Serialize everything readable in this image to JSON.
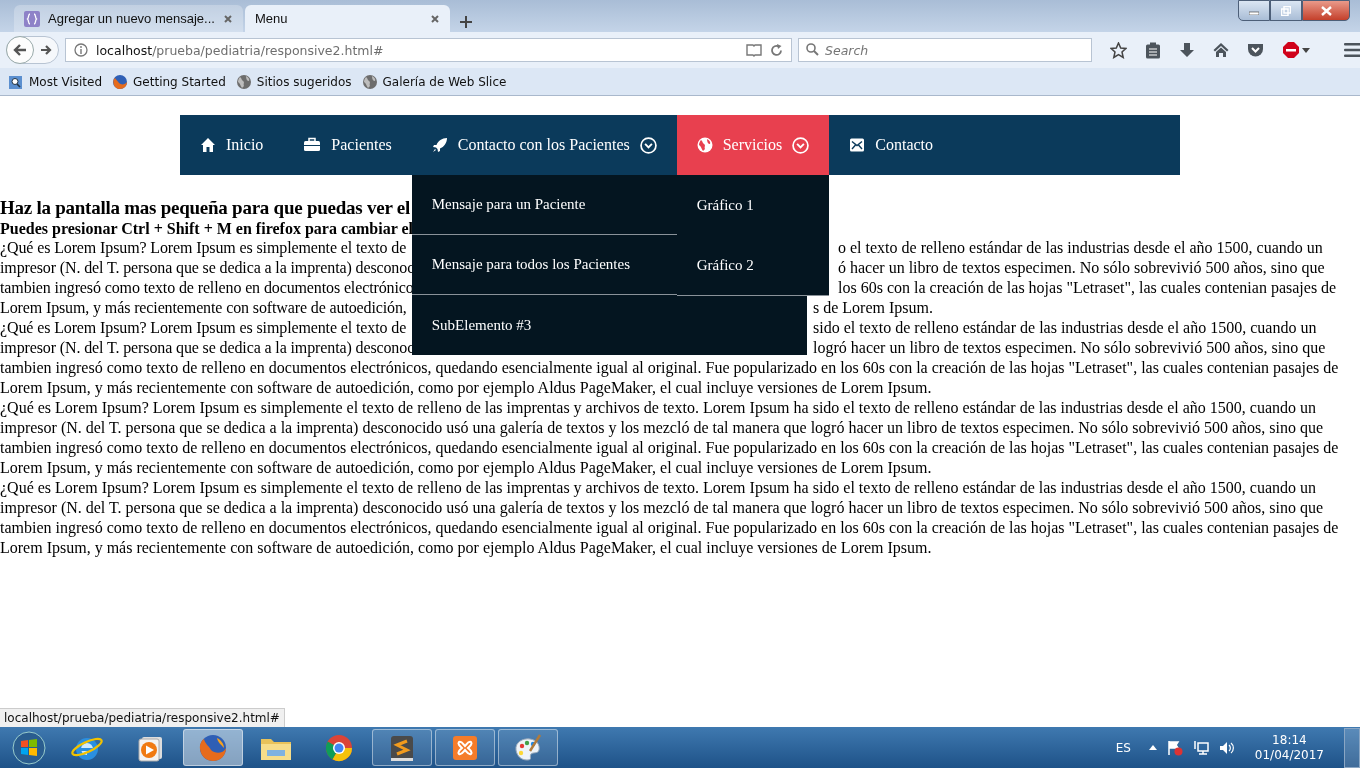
{
  "browser": {
    "tabs": [
      {
        "title": "Agregar un nuevo mensaje...",
        "selected": false
      },
      {
        "title": "Menu",
        "selected": true
      }
    ],
    "url_host": "localhost",
    "url_path": "/prueba/pediatria/responsive2.html#",
    "search": {
      "placeholder": "Search"
    },
    "bookmarks": [
      {
        "label": "Most Visited",
        "kind": "folder"
      },
      {
        "label": "Getting Started",
        "kind": "fox"
      },
      {
        "label": "Sitios sugeridos",
        "kind": "globe"
      },
      {
        "label": "Galería de Web Slice",
        "kind": "globe"
      }
    ]
  },
  "nav": {
    "items": [
      {
        "label": "Inicio",
        "selected": false
      },
      {
        "label": "Pacientes",
        "selected": false
      },
      {
        "label": "Contacto con los Pacientes",
        "selected": false,
        "expanded": true,
        "submenu": [
          "Mensaje para un Paciente",
          "Mensaje para todos los Pacientes",
          "SubElemento #3"
        ]
      },
      {
        "label": "Servicios",
        "selected": true,
        "expanded": true,
        "submenu": [
          "Gráfico 1",
          "Gráfico 2"
        ]
      },
      {
        "label": "Contacto",
        "selected": false
      }
    ]
  },
  "content": {
    "heading": "Haz la pantalla mas pequeña para que puedas ver el",
    "subheading": "Puedes presionar Ctrl + Shift + M en firefox para cambiar el",
    "covered_lines": [
      {
        "left": "¿Qué es Lorem Ipsum? Lorem Ipsum es simplemente el texto de",
        "right": "o el texto de relleno estándar de las industrias desde el año 1500, cuando un"
      },
      {
        "left": "impresor (N. del T. persona que se dedica a la imprenta) desconoc",
        "right": "ó hacer un libro de textos especimen. No sólo sobrevivió 500 años, sino que"
      },
      {
        "left": "tambien ingresó como texto de relleno en documentos electrónico",
        "right": "los 60s con la creación de las hojas \"Letraset\", las cuales contenian pasajes de"
      },
      {
        "left": "Lorem Ipsum, y más recientemente con software de autoedición,",
        "right": "s de Lorem Ipsum."
      },
      {
        "left": "¿Qué es Lorem Ipsum? Lorem Ipsum es simplemente el texto de",
        "right": "sido el texto de relleno estándar de las industrias desde el año 1500, cuando un"
      },
      {
        "left": "impresor (N. del T. persona que se dedica a la imprenta) desconoc",
        "right": "logró hacer un libro de textos especimen. No sólo sobrevivió 500 años, sino que"
      }
    ],
    "paragraphs": [
      "tambien ingresó como texto de relleno en documentos electrónicos, quedando esencialmente igual al original. Fue popularizado en los 60s con la creación de las hojas \"Letraset\", las cuales contenian pasajes de Lorem Ipsum, y más recientemente con software de autoedición, como por ejemplo Aldus PageMaker, el cual incluye versiones de Lorem Ipsum.",
      "¿Qué es Lorem Ipsum? Lorem Ipsum es simplemente el texto de relleno de las imprentas y archivos de texto. Lorem Ipsum ha sido el texto de relleno estándar de las industrias desde el año 1500, cuando un impresor (N. del T. persona que se dedica a la imprenta) desconocido usó una galería de textos y los mezcló de tal manera que logró hacer un libro de textos especimen. No sólo sobrevivió 500 años, sino que tambien ingresó como texto de relleno en documentos electrónicos, quedando esencialmente igual al original. Fue popularizado en los 60s con la creación de las hojas \"Letraset\", las cuales contenian pasajes de Lorem Ipsum, y más recientemente con software de autoedición, como por ejemplo Aldus PageMaker, el cual incluye versiones de Lorem Ipsum.",
      "¿Qué es Lorem Ipsum? Lorem Ipsum es simplemente el texto de relleno de las imprentas y archivos de texto. Lorem Ipsum ha sido el texto de relleno estándar de las industrias desde el año 1500, cuando un impresor (N. del T. persona que se dedica a la imprenta) desconocido usó una galería de textos y los mezcló de tal manera que logró hacer un libro de textos especimen. No sólo sobrevivió 500 años, sino que tambien ingresó como texto de relleno en documentos electrónicos, quedando esencialmente igual al original. Fue popularizado en los 60s con la creación de las hojas \"Letraset\", las cuales contenian pasajes de Lorem Ipsum, y más recientemente con software de autoedición, como por ejemplo Aldus PageMaker, el cual incluye versiones de Lorem Ipsum."
    ]
  },
  "status_bar": "localhost/prueba/pediatria/responsive2.html#",
  "taskbar": {
    "apps": [
      {
        "kind": "ie",
        "running": false,
        "selected": false
      },
      {
        "kind": "media",
        "running": false,
        "selected": false
      },
      {
        "kind": "firefox",
        "running": true,
        "selected": true
      },
      {
        "kind": "folder",
        "running": false,
        "selected": false
      },
      {
        "kind": "chrome",
        "running": false,
        "selected": false
      },
      {
        "kind": "editor",
        "running": true,
        "selected": false
      },
      {
        "kind": "xampp",
        "running": true,
        "selected": false
      },
      {
        "kind": "paint",
        "running": true,
        "selected": false
      }
    ],
    "language": "ES",
    "time": "18:14",
    "date": "01/04/2017"
  }
}
